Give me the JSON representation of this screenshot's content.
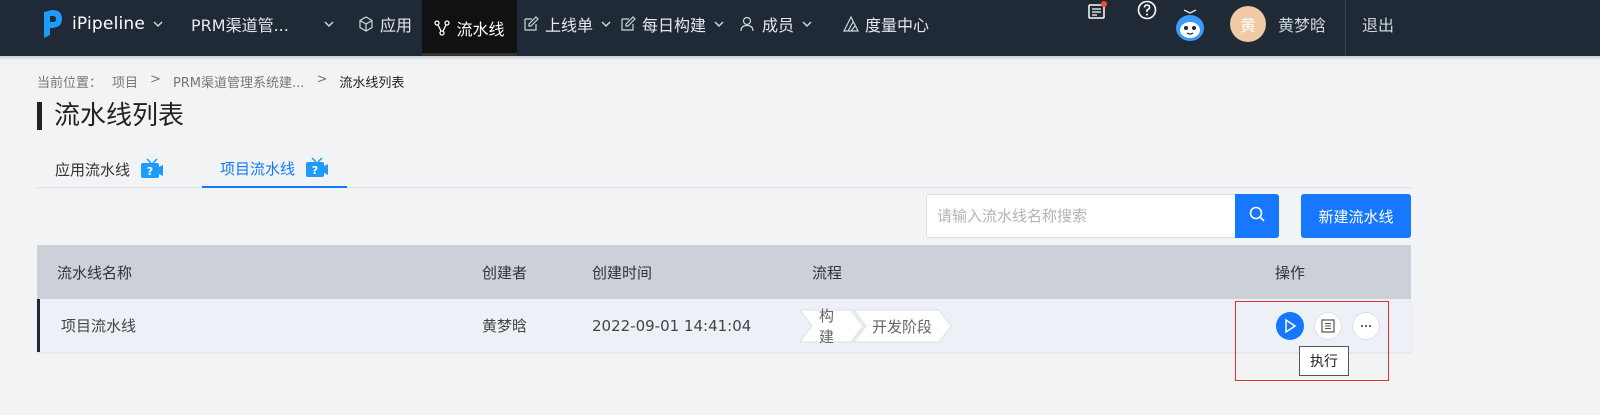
{
  "colors": {
    "nav_bg": "#1f2a36",
    "accent": "#1677ff",
    "highlight": "#e03131"
  },
  "topnav": {
    "brand": "iPipeline",
    "project": "PRM渠道管...",
    "items": [
      {
        "label": "应用",
        "icon": "cube-icon"
      },
      {
        "label": "流水线",
        "icon": "pipeline-icon",
        "active": true
      },
      {
        "label": "上线单",
        "icon": "edit-icon"
      },
      {
        "label": "每日构建",
        "icon": "edit-icon"
      },
      {
        "label": "成员",
        "icon": "user-icon"
      },
      {
        "label": "度量中心",
        "icon": "chart-icon"
      }
    ],
    "avatar_text": "黄",
    "username": "黄梦晗",
    "logout": "退出"
  },
  "breadcrumb": {
    "prefix": "当前位置：",
    "items": [
      "项目",
      ">",
      "PRM渠道管理系统建...",
      ">",
      "流水线列表"
    ]
  },
  "page_title": "流水线列表",
  "tabs": [
    {
      "label": "应用流水线"
    },
    {
      "label": "项目流水线",
      "active": true
    }
  ],
  "search": {
    "placeholder": "请输入流水线名称搜索",
    "value": ""
  },
  "new_button": "新建流水线",
  "table": {
    "headers": [
      "流水线名称",
      "创建者",
      "创建时间",
      "流程",
      "操作"
    ],
    "rows": [
      {
        "name": "项目流水线",
        "creator": "黄梦晗",
        "created": "2022-09-01 14:41:04",
        "stages": [
          "构建",
          "开发阶段"
        ]
      }
    ]
  },
  "tooltip": "执行"
}
